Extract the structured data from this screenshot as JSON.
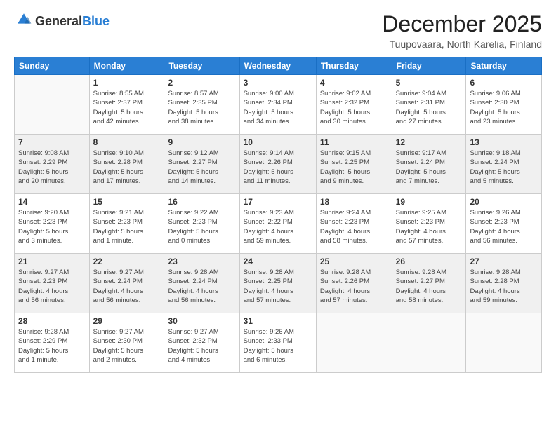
{
  "logo": {
    "general": "General",
    "blue": "Blue"
  },
  "title": "December 2025",
  "location": "Tuupovaara, North Karelia, Finland",
  "weekdays": [
    "Sunday",
    "Monday",
    "Tuesday",
    "Wednesday",
    "Thursday",
    "Friday",
    "Saturday"
  ],
  "weeks": [
    [
      {
        "day": "",
        "info": ""
      },
      {
        "day": "1",
        "info": "Sunrise: 8:55 AM\nSunset: 2:37 PM\nDaylight: 5 hours\nand 42 minutes."
      },
      {
        "day": "2",
        "info": "Sunrise: 8:57 AM\nSunset: 2:35 PM\nDaylight: 5 hours\nand 38 minutes."
      },
      {
        "day": "3",
        "info": "Sunrise: 9:00 AM\nSunset: 2:34 PM\nDaylight: 5 hours\nand 34 minutes."
      },
      {
        "day": "4",
        "info": "Sunrise: 9:02 AM\nSunset: 2:32 PM\nDaylight: 5 hours\nand 30 minutes."
      },
      {
        "day": "5",
        "info": "Sunrise: 9:04 AM\nSunset: 2:31 PM\nDaylight: 5 hours\nand 27 minutes."
      },
      {
        "day": "6",
        "info": "Sunrise: 9:06 AM\nSunset: 2:30 PM\nDaylight: 5 hours\nand 23 minutes."
      }
    ],
    [
      {
        "day": "7",
        "info": "Sunrise: 9:08 AM\nSunset: 2:29 PM\nDaylight: 5 hours\nand 20 minutes."
      },
      {
        "day": "8",
        "info": "Sunrise: 9:10 AM\nSunset: 2:28 PM\nDaylight: 5 hours\nand 17 minutes."
      },
      {
        "day": "9",
        "info": "Sunrise: 9:12 AM\nSunset: 2:27 PM\nDaylight: 5 hours\nand 14 minutes."
      },
      {
        "day": "10",
        "info": "Sunrise: 9:14 AM\nSunset: 2:26 PM\nDaylight: 5 hours\nand 11 minutes."
      },
      {
        "day": "11",
        "info": "Sunrise: 9:15 AM\nSunset: 2:25 PM\nDaylight: 5 hours\nand 9 minutes."
      },
      {
        "day": "12",
        "info": "Sunrise: 9:17 AM\nSunset: 2:24 PM\nDaylight: 5 hours\nand 7 minutes."
      },
      {
        "day": "13",
        "info": "Sunrise: 9:18 AM\nSunset: 2:24 PM\nDaylight: 5 hours\nand 5 minutes."
      }
    ],
    [
      {
        "day": "14",
        "info": "Sunrise: 9:20 AM\nSunset: 2:23 PM\nDaylight: 5 hours\nand 3 minutes."
      },
      {
        "day": "15",
        "info": "Sunrise: 9:21 AM\nSunset: 2:23 PM\nDaylight: 5 hours\nand 1 minute."
      },
      {
        "day": "16",
        "info": "Sunrise: 9:22 AM\nSunset: 2:23 PM\nDaylight: 5 hours\nand 0 minutes."
      },
      {
        "day": "17",
        "info": "Sunrise: 9:23 AM\nSunset: 2:22 PM\nDaylight: 4 hours\nand 59 minutes."
      },
      {
        "day": "18",
        "info": "Sunrise: 9:24 AM\nSunset: 2:23 PM\nDaylight: 4 hours\nand 58 minutes."
      },
      {
        "day": "19",
        "info": "Sunrise: 9:25 AM\nSunset: 2:23 PM\nDaylight: 4 hours\nand 57 minutes."
      },
      {
        "day": "20",
        "info": "Sunrise: 9:26 AM\nSunset: 2:23 PM\nDaylight: 4 hours\nand 56 minutes."
      }
    ],
    [
      {
        "day": "21",
        "info": "Sunrise: 9:27 AM\nSunset: 2:23 PM\nDaylight: 4 hours\nand 56 minutes."
      },
      {
        "day": "22",
        "info": "Sunrise: 9:27 AM\nSunset: 2:24 PM\nDaylight: 4 hours\nand 56 minutes."
      },
      {
        "day": "23",
        "info": "Sunrise: 9:28 AM\nSunset: 2:24 PM\nDaylight: 4 hours\nand 56 minutes."
      },
      {
        "day": "24",
        "info": "Sunrise: 9:28 AM\nSunset: 2:25 PM\nDaylight: 4 hours\nand 57 minutes."
      },
      {
        "day": "25",
        "info": "Sunrise: 9:28 AM\nSunset: 2:26 PM\nDaylight: 4 hours\nand 57 minutes."
      },
      {
        "day": "26",
        "info": "Sunrise: 9:28 AM\nSunset: 2:27 PM\nDaylight: 4 hours\nand 58 minutes."
      },
      {
        "day": "27",
        "info": "Sunrise: 9:28 AM\nSunset: 2:28 PM\nDaylight: 4 hours\nand 59 minutes."
      }
    ],
    [
      {
        "day": "28",
        "info": "Sunrise: 9:28 AM\nSunset: 2:29 PM\nDaylight: 5 hours\nand 1 minute."
      },
      {
        "day": "29",
        "info": "Sunrise: 9:27 AM\nSunset: 2:30 PM\nDaylight: 5 hours\nand 2 minutes."
      },
      {
        "day": "30",
        "info": "Sunrise: 9:27 AM\nSunset: 2:32 PM\nDaylight: 5 hours\nand 4 minutes."
      },
      {
        "day": "31",
        "info": "Sunrise: 9:26 AM\nSunset: 2:33 PM\nDaylight: 5 hours\nand 6 minutes."
      },
      {
        "day": "",
        "info": ""
      },
      {
        "day": "",
        "info": ""
      },
      {
        "day": "",
        "info": ""
      }
    ]
  ]
}
